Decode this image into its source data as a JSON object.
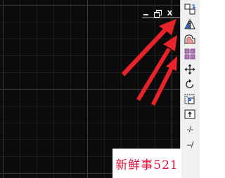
{
  "window_controls": {
    "minimize": "minimize",
    "restore": "restore",
    "close_label": "x"
  },
  "toolbar": {
    "tools": [
      {
        "name": "copy-icon"
      },
      {
        "name": "mirror-icon"
      },
      {
        "name": "offset-icon"
      },
      {
        "name": "array-icon"
      },
      {
        "name": "move-icon"
      },
      {
        "name": "rotate-icon"
      },
      {
        "name": "scale-icon"
      },
      {
        "name": "stretch-icon"
      },
      {
        "name": "trim-icon",
        "label": "-/-"
      },
      {
        "name": "extend-icon",
        "label": "--/"
      }
    ]
  },
  "annotation": {
    "arrow_color": "#e8232a",
    "arrow_count": 3
  },
  "watermark": {
    "text": "新鲜事521",
    "color": "#e0143c"
  }
}
